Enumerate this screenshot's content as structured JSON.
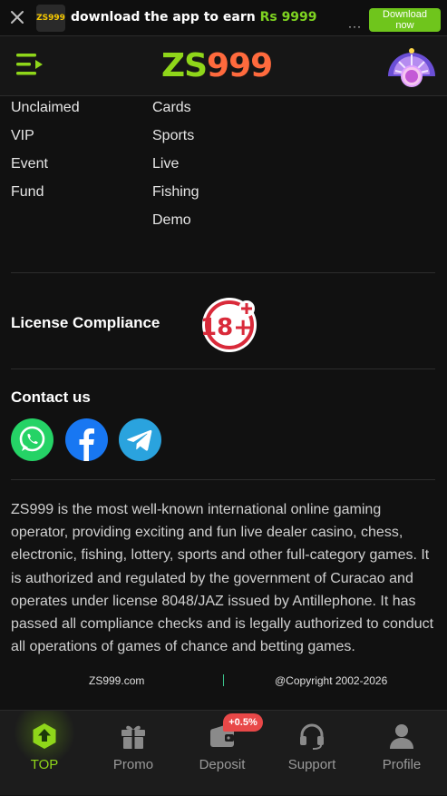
{
  "app_banner": {
    "logo_text": "ZS999",
    "message": "download the app to earn ",
    "amount": "Rs 9999",
    "download_label": "Download now"
  },
  "header": {
    "logo_part1": "ZS",
    "logo_part2": "999"
  },
  "footer_links": {
    "column1": [
      "Unclaimed",
      "VIP",
      "Event",
      "Fund"
    ],
    "column2": [
      "Cards",
      "Sports",
      "Live",
      "Fishing",
      "Demo"
    ]
  },
  "license": {
    "title": "License Compliance",
    "age_badge": "18+"
  },
  "contact": {
    "title": "Contact us",
    "channels": [
      "whatsapp-icon",
      "facebook-icon",
      "telegram-icon"
    ]
  },
  "about_text": "ZS999 is the most well-known international online gaming operator, providing exciting and fun live dealer casino, chess, electronic, fishing, lottery, sports and other full-category games. It is authorized and regulated by the government of Curacao and operates under license 8048/JAZ issued by Antillephone. It has passed all compliance checks and is legally authorized to conduct all operations of games of chance and betting games.",
  "footer": {
    "domain": "ZS999.com",
    "copyright": "@Copyright 2002-2026"
  },
  "bottom_nav": {
    "items": [
      {
        "label": "TOP",
        "icon": "top-icon",
        "active": true
      },
      {
        "label": "Promo",
        "icon": "gift-icon",
        "active": false
      },
      {
        "label": "Deposit",
        "icon": "wallet-icon",
        "active": false,
        "badge": "+0.5%"
      },
      {
        "label": "Support",
        "icon": "headset-icon",
        "active": false
      },
      {
        "label": "Profile",
        "icon": "user-icon",
        "active": false
      }
    ]
  },
  "colors": {
    "accent_green": "#8fd61a",
    "download_button": "#6fc51c",
    "badge_red": "#e84848",
    "background": "#111111"
  }
}
